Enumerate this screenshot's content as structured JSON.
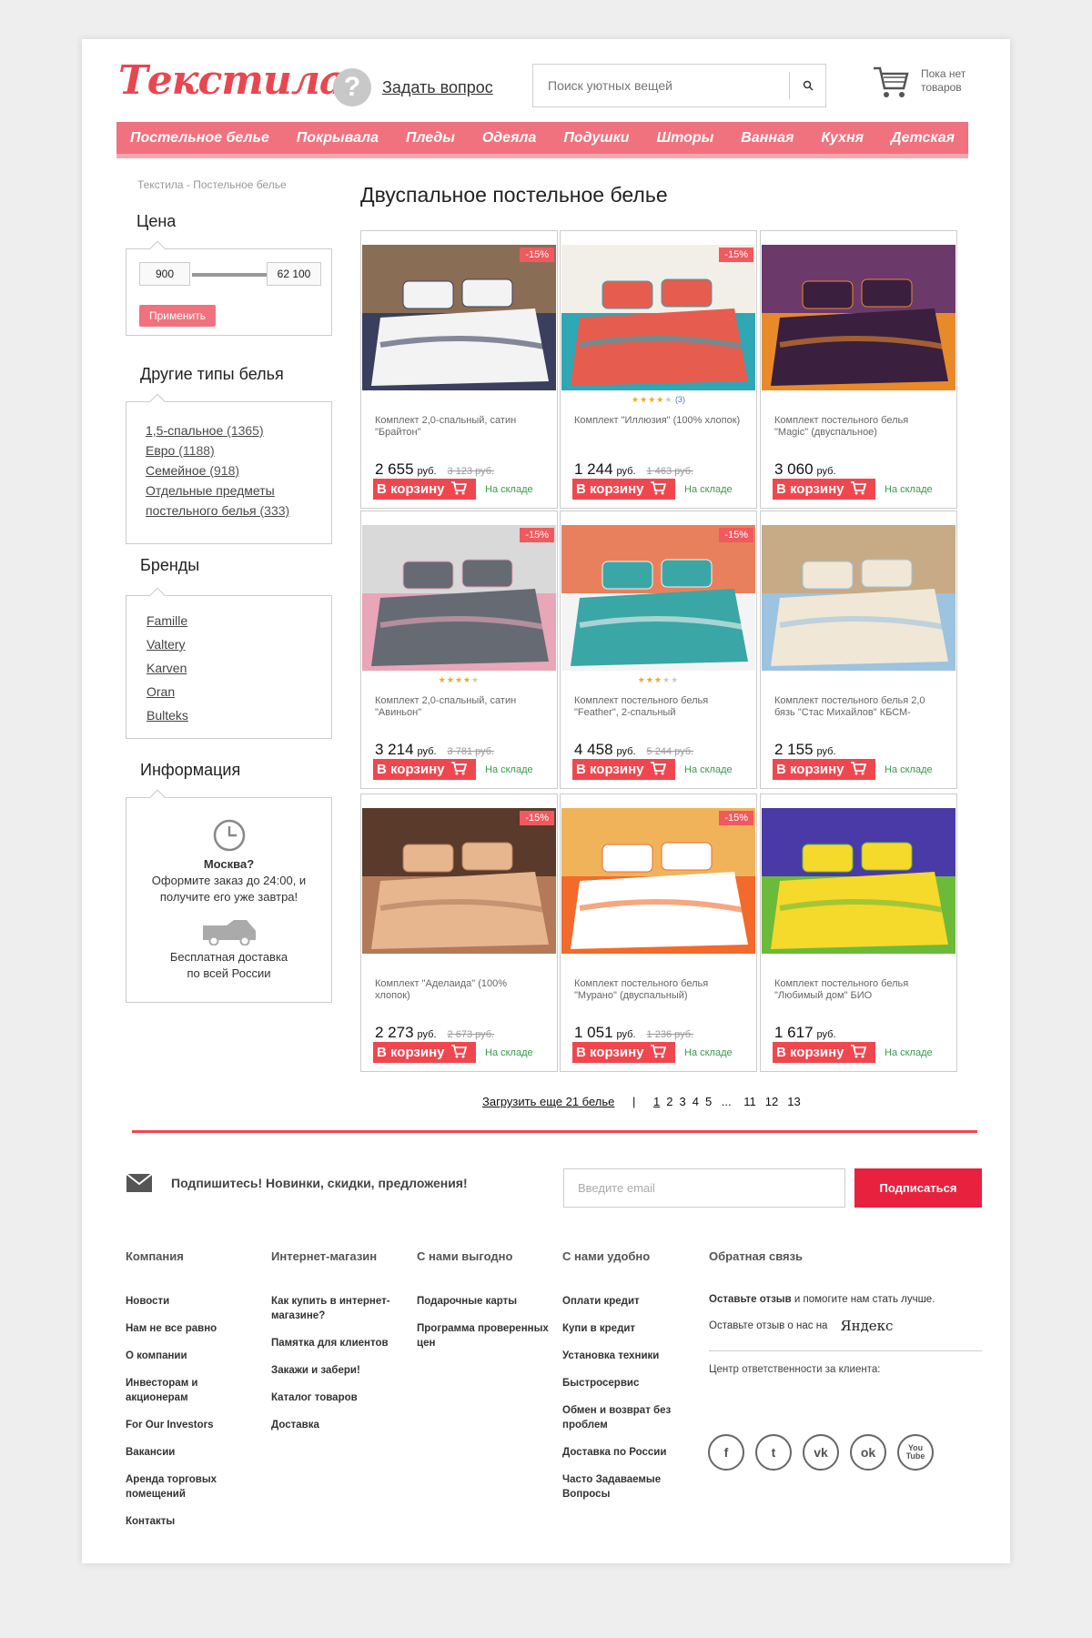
{
  "header": {
    "logo": "Текстила",
    "ask_link": "Задать вопрос",
    "search_placeholder": "Поиск уютных вещей",
    "cart_text": "Пока нет товаров"
  },
  "nav": [
    "Постельное белье",
    "Покрывала",
    "Пледы",
    "Одеяла",
    "Подушки",
    "Шторы",
    "Ванная",
    "Кухня",
    "Детская"
  ],
  "breadcrumb": "Текстила - Постельное белье",
  "page_title": "Двуспальное постельное белье",
  "filters": {
    "price_heading": "Цена",
    "price_min": "900",
    "price_max": "62 100",
    "apply_label": "Применить",
    "types_heading": "Другие типы белья",
    "types": [
      {
        "label": "1,5-спальное",
        "count": "(1365)"
      },
      {
        "label": "Евро",
        "count": "(1188)"
      },
      {
        "label": "Семейное",
        "count": "(918)"
      },
      {
        "label": "Отдельные предметы постельного белья",
        "count": "(333)"
      }
    ],
    "brands_heading": "Бренды",
    "brands": [
      "Famille",
      "Valtery",
      "Karven",
      "Oran",
      "Bulteks"
    ],
    "info_heading": "Информация",
    "info_city": "Москва?",
    "info_order": "Оформите заказ до 24:00, и получите его уже завтра!",
    "info_delivery": "Бесплатная доставка по всей России"
  },
  "products": [
    {
      "title": "Комплект 2,0-спальный, сатин \"Брайтон\"",
      "price": "2 655",
      "currency": "руб.",
      "old_price": "3 123 руб.",
      "badge": "-15%",
      "stars": 0,
      "reviews": "",
      "buy": "В корзину",
      "stock": "На складе"
    },
    {
      "title": "Комплект \"Иллюзия\" (100% хлопок)",
      "price": "1 244",
      "currency": "руб.",
      "old_price": "1 463 руб.",
      "badge": "-15%",
      "stars": 4,
      "reviews": "(3)",
      "buy": "В корзину",
      "stock": "На складе"
    },
    {
      "title": "Комплект постельного белья \"Magic\" (двуспальное)",
      "price": "3 060",
      "currency": "руб.",
      "old_price": "",
      "badge": "",
      "stars": 0,
      "reviews": "",
      "buy": "В корзину",
      "stock": "На складе"
    },
    {
      "title": "Комплект 2,0-спальный, сатин \"Авиньон\"",
      "price": "3 214",
      "currency": "руб.",
      "old_price": "3 781 руб.",
      "badge": "-15%",
      "stars": 4,
      "reviews": "",
      "buy": "В корзину",
      "stock": "На складе"
    },
    {
      "title": "Комплект постельного белья \"Feather\", 2-спальный",
      "price": "4 458",
      "currency": "руб.",
      "old_price": "5 244 руб.",
      "badge": "-15%",
      "stars": 3,
      "reviews": "",
      "buy": "В корзину",
      "stock": "На складе"
    },
    {
      "title": "Комплект постельного белья 2,0 бязь \"Стас Михайлов\" КБСМ-",
      "price": "2 155",
      "currency": "руб.",
      "old_price": "",
      "badge": "",
      "stars": 0,
      "reviews": "",
      "buy": "В корзину",
      "stock": "На складе"
    },
    {
      "title": "Комплект \"Аделаида\" (100% хлопок)",
      "price": "2 273",
      "currency": "руб.",
      "old_price": "2 673 руб.",
      "badge": "-15%",
      "stars": 0,
      "reviews": "",
      "buy": "В корзину",
      "stock": "На складе"
    },
    {
      "title": "Комплект постельного белья \"Мурано\" (двуспальный)",
      "price": "1 051",
      "currency": "руб.",
      "old_price": "1 236 руб.",
      "badge": "-15%",
      "stars": 0,
      "reviews": "",
      "buy": "В корзину",
      "stock": "На складе"
    },
    {
      "title": "Комплект постельного белья \"Любимый дом\" БИО",
      "price": "1 617",
      "currency": "руб.",
      "old_price": "",
      "badge": "",
      "stars": 0,
      "reviews": "",
      "buy": "В корзину",
      "stock": "На складе"
    }
  ],
  "product_colors": [
    [
      "#3b3f5e",
      "#f3f3f3",
      "#8a6d55"
    ],
    [
      "#2fa7b5",
      "#e65c4f",
      "#f2efe8"
    ],
    [
      "#e98a2a",
      "#3a1f3f",
      "#6b3a6a"
    ],
    [
      "#e8a6b8",
      "#666a72",
      "#d9d9d9"
    ],
    [
      "#f4f4f4",
      "#3aa6a6",
      "#e8805d"
    ],
    [
      "#9cc3df",
      "#f1e7d6",
      "#c6ab86"
    ],
    [
      "#b37a5a",
      "#e7b68f",
      "#5a3a2a"
    ],
    [
      "#f26a2c",
      "#ffffff",
      "#f0b35a"
    ],
    [
      "#6cba3a",
      "#f5d92b",
      "#4a3aa8"
    ]
  ],
  "pagination": {
    "load_more": "Загрузить еще 21 белье",
    "pages_a": [
      "1",
      "2",
      "3",
      "4",
      "5"
    ],
    "ellipsis": "...",
    "pages_b": [
      "11",
      "12",
      "13"
    ]
  },
  "subscribe": {
    "text": "Подпишитесь! Новинки, скидки, предложения!",
    "placeholder": "Введите email",
    "button": "Подписаться"
  },
  "footer": {
    "columns": [
      {
        "heading": "Компания",
        "links": [
          "Новости",
          "Нам не все равно",
          "О компании",
          "Инвесторам и акционерам",
          "For Our Investors",
          "Вакансии",
          "Аренда торговых помещений",
          "Контакты"
        ]
      },
      {
        "heading": "Интернет-магазин",
        "links": [
          "Как купить в интернет-магазине?",
          "Памятка для клиентов",
          "Закажи и забери!",
          "Каталог товаров",
          "Доставка"
        ]
      },
      {
        "heading": "С нами выгодно",
        "links": [
          "Подарочные карты",
          "Программа проверенных цен"
        ]
      },
      {
        "heading": "С нами удобно",
        "links": [
          "Оплати кредит",
          "Купи в кредит",
          "Установка техники",
          "Быстросервис",
          "Обмен и возврат без проблем",
          "Доставка по России",
          "Часто Задаваемые Вопросы"
        ]
      }
    ],
    "feedback_heading": "Обратная связь",
    "feedback_bold": "Оставьте отзыв",
    "feedback_rest": "и помогите нам стать лучше.",
    "feedback_yandex": "Оставьте отзыв о нас на",
    "yandex": "Яндекс",
    "responsibility": "Центр ответственности за клиента:",
    "social": [
      {
        "name": "facebook-icon",
        "glyph": "f"
      },
      {
        "name": "twitter-icon",
        "glyph": "t"
      },
      {
        "name": "vk-icon",
        "glyph": "vk"
      },
      {
        "name": "odnoklassniki-icon",
        "glyph": "ok"
      },
      {
        "name": "youtube-icon",
        "glyph": "You Tube"
      }
    ]
  }
}
